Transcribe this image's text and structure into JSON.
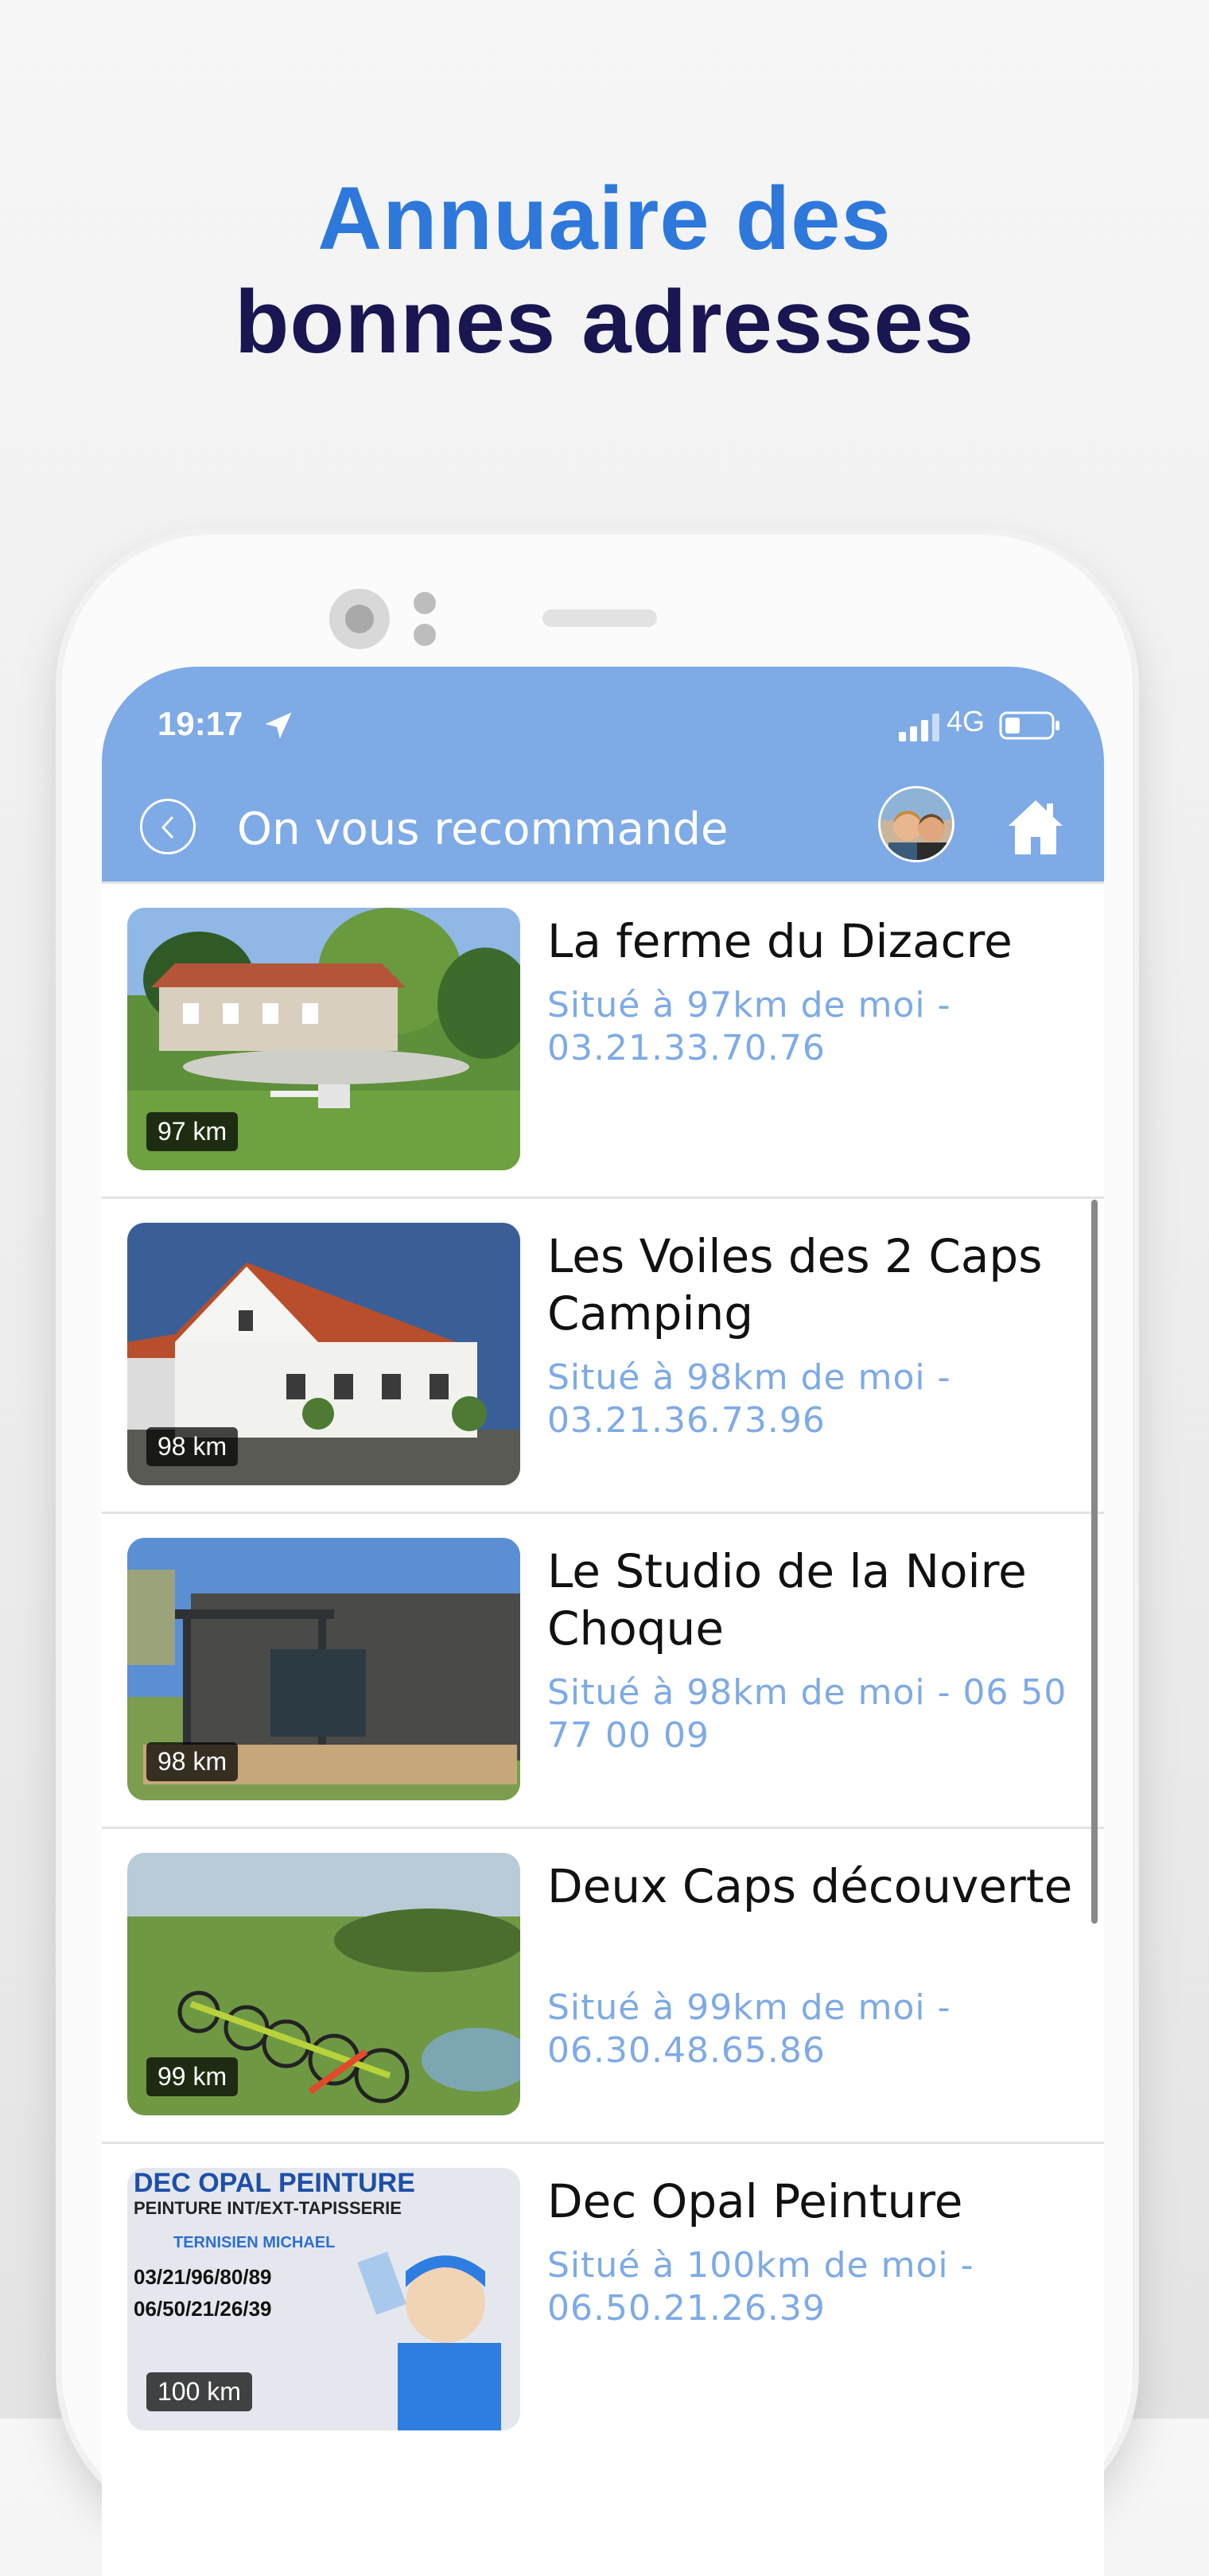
{
  "headline": {
    "line1": "Annuaire des",
    "line2": "bonnes adresses"
  },
  "status_bar": {
    "time": "19:17",
    "network": "4G"
  },
  "header": {
    "title": "On vous recommande"
  },
  "listings": [
    {
      "name": "La ferme du Dizacre",
      "distance": "97 km",
      "meta": "Situé à 97km de moi - 03.21.33.70.76",
      "image": "farmhouse-photo"
    },
    {
      "name": "Les Voiles des 2 Caps Camping",
      "distance": "98 km",
      "meta": "Situé à 98km de moi - 03.21.36.73.96",
      "image": "white-house-photo"
    },
    {
      "name": "Le Studio de la Noire Choque",
      "distance": "98 km",
      "meta": "Situé à 98km de moi -  06 50 77 00 09",
      "image": "wood-studio-photo"
    },
    {
      "name": "Deux Caps découverte",
      "distance": "99 km",
      "meta": "Situé à 99km de moi - 06.30.48.65.86",
      "image": "bikes-photo"
    },
    {
      "name": "Dec Opal Peinture",
      "distance": "100 km",
      "meta": "Situé à 100km de moi - 06.50.21.26.39",
      "image": "painter-flyer"
    }
  ],
  "flyer": {
    "l1": "DEC OPAL PEINTURE",
    "l2": "PEINTURE INT/EXT-TAPISSERIE",
    "l3": "TERNISIEN MICHAEL",
    "l4": "03/21/96/80/89",
    "l5": "06/50/21/26/39"
  },
  "colors": {
    "accent": "#7eaae6",
    "headline_blue": "#2d78da",
    "headline_dark": "#1a1652"
  }
}
